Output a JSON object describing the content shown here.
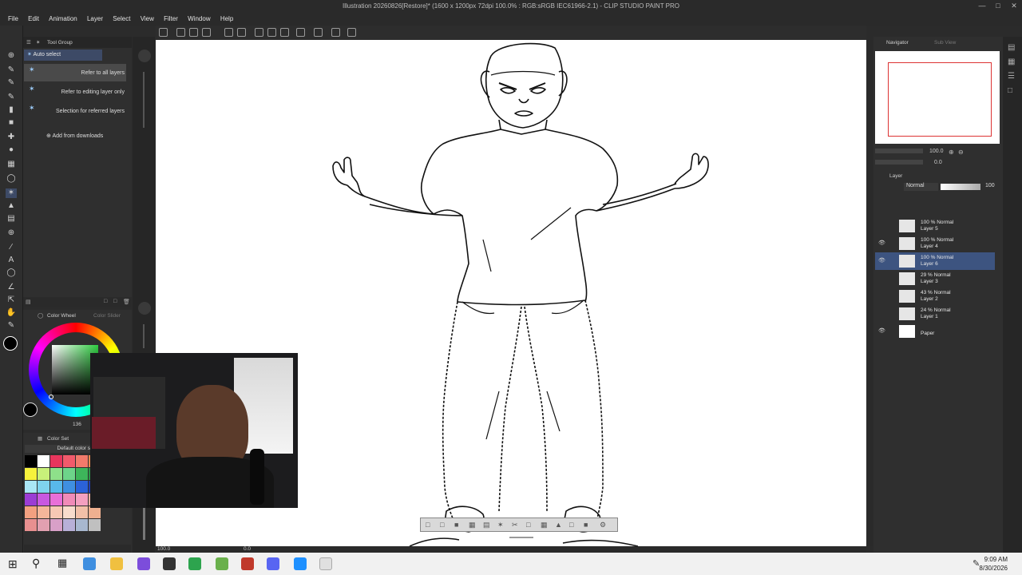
{
  "window": {
    "title": "Illustration 20260826[Restore]* (1600 x 1200px 72dpi 100.0% : RGB:sRGB IEC61966-2.1) - CLIP STUDIO PAINT PRO"
  },
  "menu": [
    "File",
    "Edit",
    "Animation",
    "Layer",
    "Select",
    "View",
    "Filter",
    "Window",
    "Help"
  ],
  "subtool": {
    "tab_label": "Tool Group",
    "header": "Auto select",
    "items": [
      {
        "label": "Refer to all layers",
        "selected": true
      },
      {
        "label": "Refer to editing layer only",
        "selected": false
      },
      {
        "label": "Selection for referred layers",
        "selected": false
      }
    ],
    "add_label": "Add from downloads"
  },
  "color_wheel": {
    "tab_label": "Color Wheel",
    "tab2_label": "Color Slider",
    "readout": "136",
    "main_color": "#000000",
    "sub_color": "#000000"
  },
  "color_set": {
    "tab_label": "Color Set",
    "set_name": "Default color set",
    "swatches": [
      "#000000",
      "#ffffff",
      "#e8365d",
      "#f25a6b",
      "#f27a6b",
      "#f38a50",
      "#f6f23c",
      "#c8f07a",
      "#8ee08a",
      "#6dd48a",
      "#3db55a",
      "#2c9a4a",
      "#a9e6f5",
      "#7fd3ee",
      "#58b8ea",
      "#3f8fe0",
      "#2b62d9",
      "#2240b8",
      "#9b3cd4",
      "#c858e0",
      "#e86fd8",
      "#f08bb8",
      "#f4a0c0",
      "#f2b2a0",
      "#f2a080",
      "#f4b69a",
      "#f6c8b4",
      "#f8dccc",
      "#f2c0a8",
      "#eeb090",
      "#e89090",
      "#e2a0b0",
      "#d8a0c8",
      "#b8b0d8",
      "#a8b8d0",
      "#c0c0c0"
    ]
  },
  "navigator": {
    "tab_label": "Navigator",
    "tab2_label": "Sub View",
    "zoom": "100.0",
    "rotation": "0.0"
  },
  "layer_panel": {
    "tab_label": "Layer",
    "blend_mode": "Normal",
    "opacity": "100",
    "layers": [
      {
        "mode": "100 % Normal",
        "name": "Layer 5",
        "visible": false,
        "selected": false
      },
      {
        "mode": "100 % Normal",
        "name": "Layer 4",
        "visible": true,
        "selected": false
      },
      {
        "mode": "100 % Normal",
        "name": "Layer 6",
        "visible": true,
        "selected": true
      },
      {
        "mode": "29 % Normal",
        "name": "Layer 3",
        "visible": false,
        "selected": false
      },
      {
        "mode": "43 % Normal",
        "name": "Layer 2",
        "visible": false,
        "selected": false
      },
      {
        "mode": "24 % Normal",
        "name": "Layer 1",
        "visible": false,
        "selected": false
      },
      {
        "mode": "",
        "name": "Paper",
        "visible": true,
        "selected": false
      }
    ]
  },
  "status": {
    "zoom": "100.0",
    "angle": "0.0"
  },
  "taskbar": {
    "time": "9:09 AM",
    "date": "8/30/2026"
  }
}
